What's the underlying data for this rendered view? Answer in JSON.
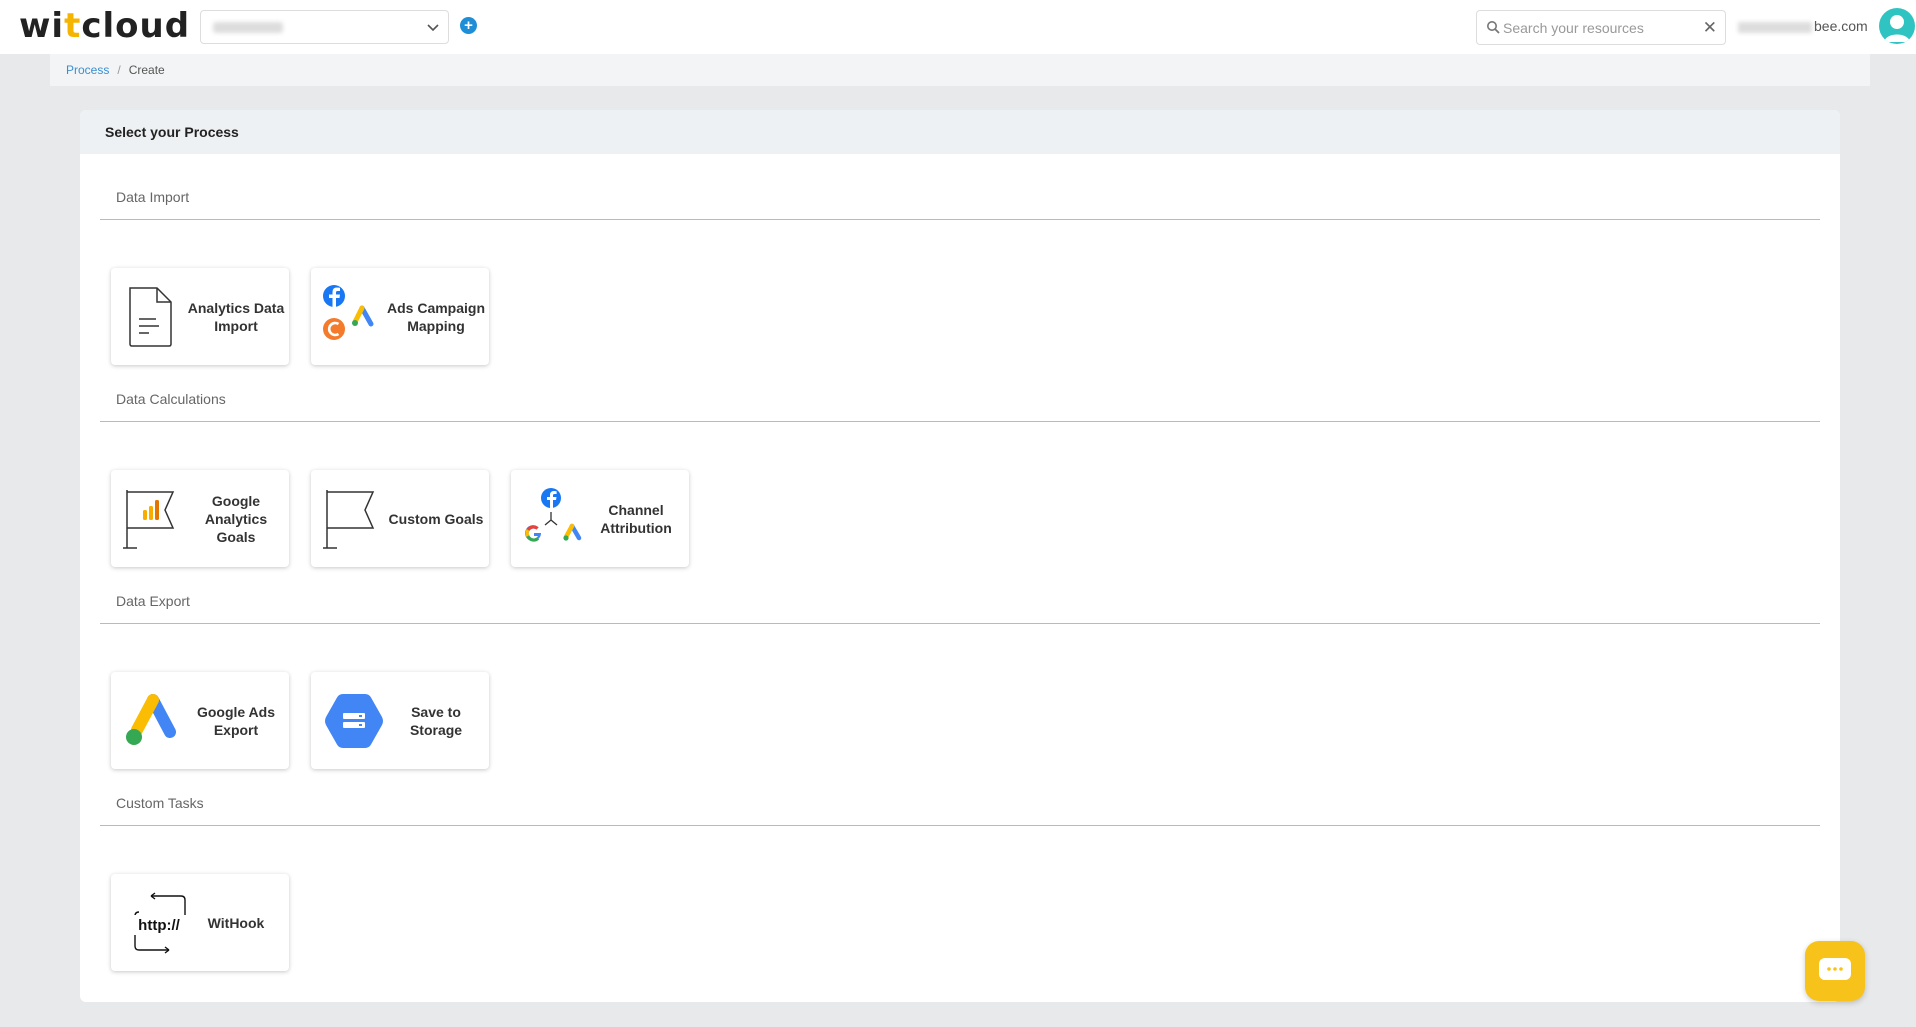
{
  "header": {
    "logo_left": "wi",
    "logo_accent": "t",
    "logo_right": "cloud",
    "search_placeholder": "Search your resources",
    "user_email_suffix": "bee.com"
  },
  "breadcrumb": {
    "parent": "Process",
    "separator": "/",
    "current": "Create"
  },
  "card": {
    "title": "Select your Process"
  },
  "sections": {
    "data_import": {
      "title": "Data Import",
      "tiles": [
        "Analytics Data Import",
        "Ads Campaign Mapping"
      ]
    },
    "data_calculations": {
      "title": "Data Calculations",
      "tiles": [
        "Google Analytics Goals",
        "Custom Goals",
        "Channel Attribution"
      ]
    },
    "data_export": {
      "title": "Data Export",
      "tiles": [
        "Google Ads Export",
        "Save to Storage"
      ]
    },
    "custom_tasks": {
      "title": "Custom Tasks",
      "tiles": [
        "WitHook"
      ]
    }
  },
  "icons": {
    "withook_text": "http://",
    "colors": {
      "facebook": "#1877f2",
      "google_blue": "#4285f4",
      "google_yellow": "#fbbc04",
      "google_green": "#34a853",
      "google_red": "#ea4335",
      "orange": "#f37b2b",
      "teal_avatar": "#2fc4c2",
      "chat_yellow": "#f7c31b"
    }
  }
}
